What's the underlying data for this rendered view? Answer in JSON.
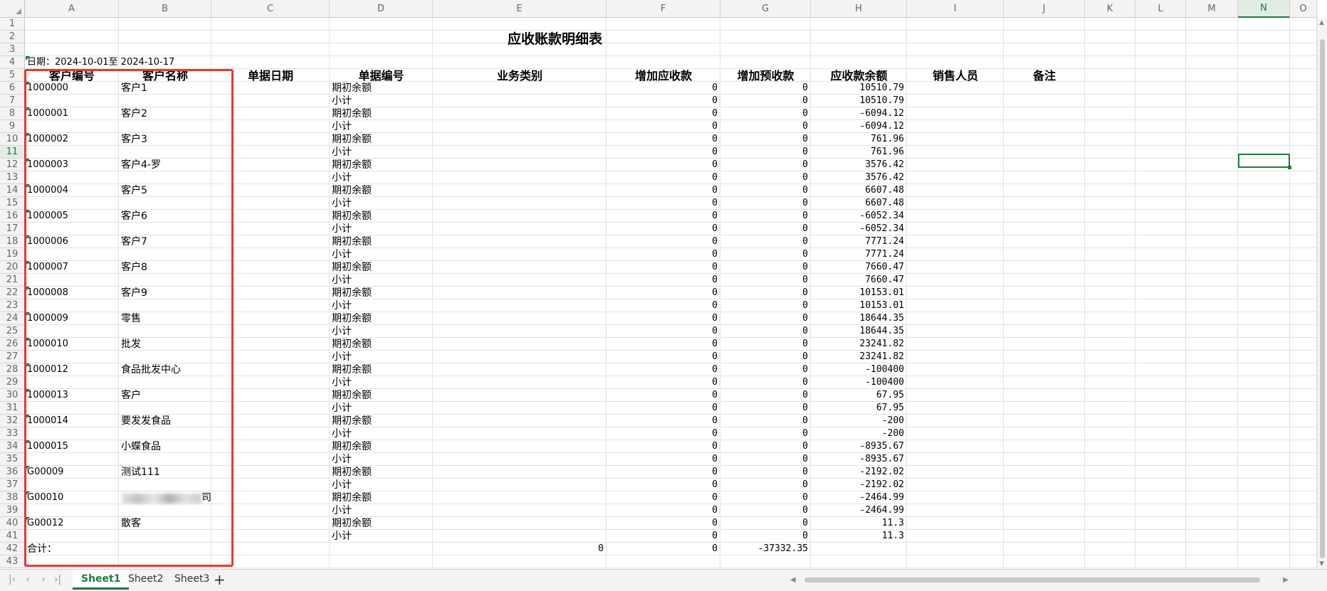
{
  "columns": [
    "A",
    "B",
    "C",
    "D",
    "E",
    "F",
    "G",
    "H",
    "I",
    "J",
    "K",
    "L",
    "M",
    "N",
    "O"
  ],
  "selected_column": "N",
  "selected_row": "11",
  "title": "应收账款明细表",
  "date_range": "日期：2024-10-01至 2024-10-17",
  "headers": [
    "客户编号",
    "客户名称",
    "单据日期",
    "单据编号",
    "业务类别",
    "增加应收款",
    "增加预收款",
    "应收款余额",
    "销售人员",
    "备注"
  ],
  "opening_label": "期初余额",
  "subtotal_label": "小计",
  "customers": [
    {
      "code": "1000000",
      "name": "客户1",
      "f": "0",
      "g": "0",
      "balance": "10510.79"
    },
    {
      "code": "1000001",
      "name": "客户2",
      "f": "0",
      "g": "0",
      "balance": "-6094.12"
    },
    {
      "code": "1000002",
      "name": "客户3",
      "f": "0",
      "g": "0",
      "balance": "761.96"
    },
    {
      "code": "1000003",
      "name": "客户4-罗",
      "f": "0",
      "g": "0",
      "balance": "3576.42"
    },
    {
      "code": "1000004",
      "name": "客户5",
      "f": "0",
      "g": "0",
      "balance": "6607.48"
    },
    {
      "code": "1000005",
      "name": "客户6",
      "f": "0",
      "g": "0",
      "balance": "-6052.34"
    },
    {
      "code": "1000006",
      "name": "客户7",
      "f": "0",
      "g": "0",
      "balance": "7771.24"
    },
    {
      "code": "1000007",
      "name": "客户8",
      "f": "0",
      "g": "0",
      "balance": "7660.47"
    },
    {
      "code": "1000008",
      "name": "客户9",
      "f": "0",
      "g": "0",
      "balance": "10153.01"
    },
    {
      "code": "1000009",
      "name": "零售",
      "f": "0",
      "g": "0",
      "balance": "18644.35"
    },
    {
      "code": "1000010",
      "name": "批发",
      "f": "0",
      "g": "0",
      "balance": "23241.82"
    },
    {
      "code": "1000012",
      "name": "食品批发中心",
      "f": "0",
      "g": "0",
      "balance": "-100400"
    },
    {
      "code": "1000013",
      "name": "客户",
      "f": "0",
      "g": "0",
      "balance": "67.95"
    },
    {
      "code": "1000014",
      "name": "要发发食品",
      "f": "0",
      "g": "0",
      "balance": "-200"
    },
    {
      "code": "1000015",
      "name": "小蝶食品",
      "f": "0",
      "g": "0",
      "balance": "-8935.67"
    },
    {
      "code": "G00009",
      "name": "测试111",
      "f": "0",
      "g": "0",
      "balance": "-2192.02"
    },
    {
      "code": "G00010",
      "name": "司",
      "f": "0",
      "g": "0",
      "balance": "-2464.99"
    },
    {
      "code": "G00012",
      "name": "散客",
      "f": "0",
      "g": "0",
      "balance": "11.3"
    }
  ],
  "total": {
    "label": "合计：",
    "e": "0",
    "f": "0",
    "g": "-37332.35"
  },
  "sheets": [
    {
      "label": "Sheet1",
      "active": true
    },
    {
      "label": "Sheet2",
      "active": false
    },
    {
      "label": "Sheet3",
      "active": false
    }
  ],
  "add_sheet": "+"
}
